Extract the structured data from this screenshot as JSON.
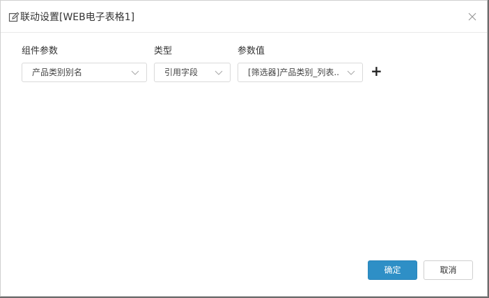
{
  "dialog": {
    "title": "联动设置[WEB电子表格1]"
  },
  "columns": {
    "param_label": "组件参数",
    "type_label": "类型",
    "value_label": "参数值"
  },
  "row": {
    "param_value": "产品类别别名",
    "type_value": "引用字段",
    "value_value": "[筛选器]产品类别_列表..."
  },
  "add_label": "+",
  "footer": {
    "ok_label": "确定",
    "cancel_label": "取消"
  },
  "colors": {
    "primary": "#2e8fc6",
    "border": "#d9d9d9"
  },
  "icons": {
    "title": "edit-icon",
    "close": "close-icon",
    "dropdown": "chevron-down-icon"
  }
}
